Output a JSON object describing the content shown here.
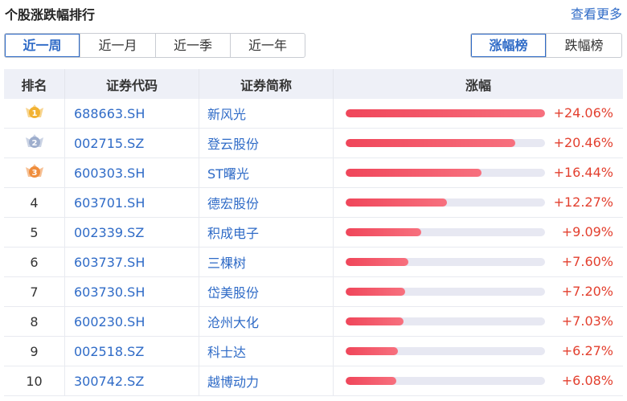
{
  "header": {
    "title": "个股涨跌幅排行",
    "more_label": "查看更多"
  },
  "period_tabs": [
    {
      "label": "近一周",
      "active": true
    },
    {
      "label": "近一月",
      "active": false
    },
    {
      "label": "近一季",
      "active": false
    },
    {
      "label": "近一年",
      "active": false
    }
  ],
  "rank_tabs": [
    {
      "label": "涨幅榜",
      "active": true
    },
    {
      "label": "跌幅榜",
      "active": false
    }
  ],
  "table": {
    "columns": [
      "排名",
      "证券代码",
      "证券简称",
      "涨幅"
    ],
    "max_change": 24.06,
    "rows": [
      {
        "rank": "1",
        "medal": "gold-medal-icon",
        "code": "688663.SH",
        "name": "新风光",
        "change": "+24.06%",
        "value": 24.06
      },
      {
        "rank": "2",
        "medal": "silver-medal-icon",
        "code": "002715.SZ",
        "name": "登云股份",
        "change": "+20.46%",
        "value": 20.46
      },
      {
        "rank": "3",
        "medal": "bronze-medal-icon",
        "code": "600303.SH",
        "name": "ST曙光",
        "change": "+16.44%",
        "value": 16.44
      },
      {
        "rank": "4",
        "medal": null,
        "code": "603701.SH",
        "name": "德宏股份",
        "change": "+12.27%",
        "value": 12.27
      },
      {
        "rank": "5",
        "medal": null,
        "code": "002339.SZ",
        "name": "积成电子",
        "change": "+9.09%",
        "value": 9.09
      },
      {
        "rank": "6",
        "medal": null,
        "code": "603737.SH",
        "name": "三棵树",
        "change": "+7.60%",
        "value": 7.6
      },
      {
        "rank": "7",
        "medal": null,
        "code": "603730.SH",
        "name": "岱美股份",
        "change": "+7.20%",
        "value": 7.2
      },
      {
        "rank": "8",
        "medal": null,
        "code": "600230.SH",
        "name": "沧州大化",
        "change": "+7.03%",
        "value": 7.03
      },
      {
        "rank": "9",
        "medal": null,
        "code": "002518.SZ",
        "name": "科士达",
        "change": "+6.27%",
        "value": 6.27
      },
      {
        "rank": "10",
        "medal": null,
        "code": "300742.SZ",
        "name": "越博动力",
        "change": "+6.08%",
        "value": 6.08
      }
    ]
  },
  "colors": {
    "accent": "#2f6bc7",
    "up": "#e3402f",
    "gold": "#f2b233",
    "silver": "#9eaecd",
    "bronze": "#ef8d3c"
  }
}
